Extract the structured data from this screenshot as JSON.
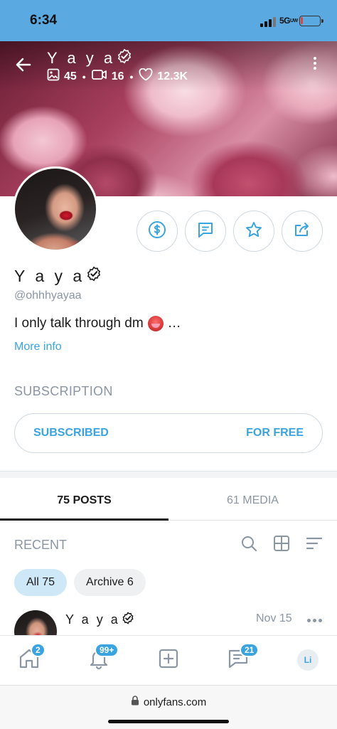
{
  "status_bar": {
    "time": "6:34",
    "network": "5G",
    "network_sub": "UW",
    "battery_level": 0.08,
    "colors": {
      "background": "#5aa9e0",
      "battery_low": "#e0443a"
    }
  },
  "header": {
    "title": "Y a y a",
    "stats": {
      "photos": "45",
      "videos": "16",
      "likes": "12.3K"
    }
  },
  "profile": {
    "name": "Y a y a",
    "handle": "@ohhhyayaa",
    "bio_text": "I only talk through dm",
    "bio_suffix": "…",
    "more_info": "More info"
  },
  "actions": [
    {
      "name": "tip-button",
      "icon": "dollar-icon"
    },
    {
      "name": "message-button",
      "icon": "chat-icon"
    },
    {
      "name": "favorite-button",
      "icon": "star-icon"
    },
    {
      "name": "share-button",
      "icon": "share-icon"
    }
  ],
  "subscription": {
    "label": "SUBSCRIPTION",
    "status": "SUBSCRIBED",
    "price": "FOR FREE"
  },
  "tabs": [
    {
      "label": "75 POSTS",
      "active": true
    },
    {
      "label": "61 MEDIA",
      "active": false
    }
  ],
  "feed": {
    "section_label": "RECENT",
    "filters": [
      {
        "label": "All 75",
        "active": true
      },
      {
        "label": "Archive 6",
        "active": false
      }
    ],
    "post": {
      "author": "Y a y a",
      "date": "Nov 15"
    }
  },
  "bottom_nav": {
    "home_badge": "2",
    "notifications_badge": "99+",
    "messages_badge": "21",
    "profile_initials": "Li"
  },
  "browser": {
    "url": "onlyfans.com"
  },
  "colors": {
    "accent": "#3aa4e0",
    "muted": "#8a96a3",
    "text": "#1b1b1b",
    "border": "#cfd8e0"
  }
}
